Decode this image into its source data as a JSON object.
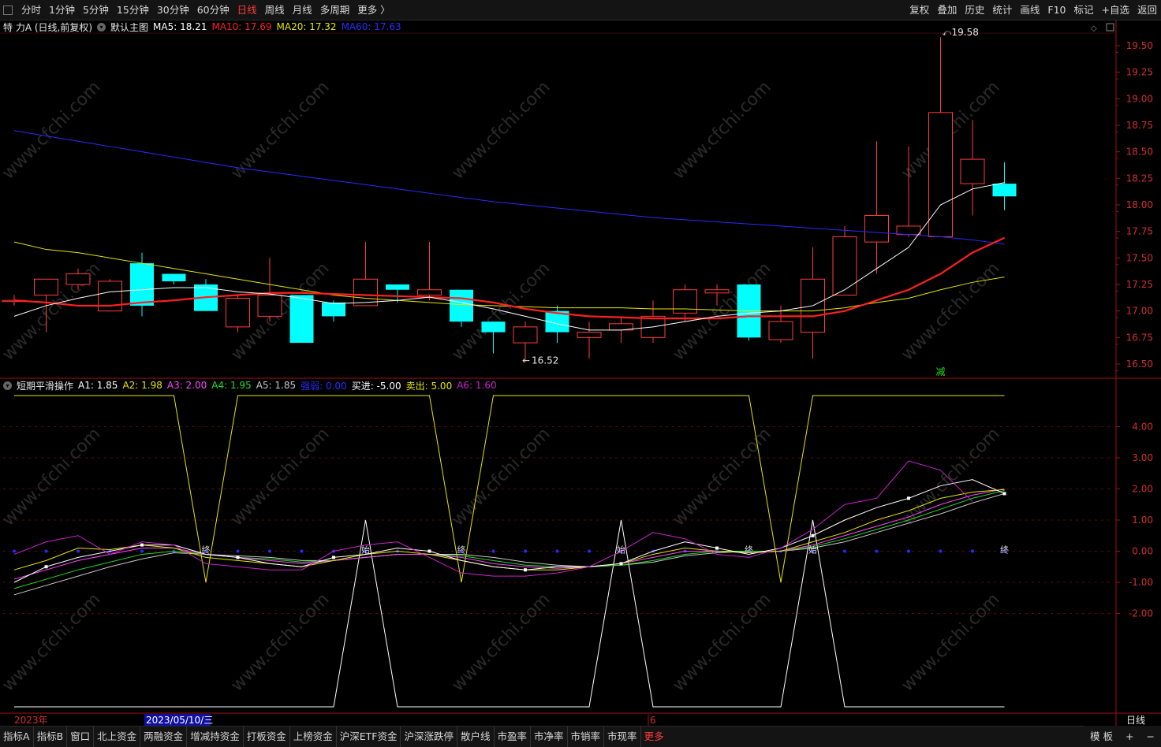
{
  "top_tabs": [
    "分时",
    "1分钟",
    "5分钟",
    "15分钟",
    "30分钟",
    "60分钟",
    "日线",
    "周线",
    "月线",
    "多周期",
    "更多 〉"
  ],
  "top_active": "日线",
  "top_right": [
    "复权",
    "叠加",
    "历史",
    "统计",
    "画线",
    "F10",
    "标记",
    "+自选",
    "返回"
  ],
  "main_legend": {
    "name": "特 力A (日线,前复权)",
    "template": "默认主图",
    "ma5": "MA5: 18.21",
    "ma10": "MA10: 17.69",
    "ma20": "MA20: 17.32",
    "ma60": "MA60: 17.63"
  },
  "sub_legend": {
    "name": "短期平滑操作",
    "a1": "A1: 1.85",
    "a2": "A2: 1.98",
    "a3": "A3: 2.00",
    "a4": "A4: 1.95",
    "a5": "A5: 1.85",
    "strong": "强弱: 0.00",
    "buy": "买进: -5.00",
    "sell": "卖出: 5.00",
    "a6": "A6: 1.60"
  },
  "colors": {
    "up": "#ff3b3b",
    "down": "#00ffff",
    "ma5": "#ffffff",
    "ma10": "#ff2020",
    "ma20": "#e6e600",
    "ma60": "#2a2aff",
    "a6": "#cc22cc"
  },
  "price_axis": [
    "19.50",
    "19.25",
    "19.00",
    "18.75",
    "18.50",
    "18.25",
    "18.00",
    "17.75",
    "17.50",
    "17.25",
    "17.00",
    "16.75",
    "16.50"
  ],
  "sub_axis": [
    "4.00",
    "3.00",
    "2.00",
    "1.00",
    "0.00",
    "-1.00",
    "-2.00"
  ],
  "annotations": {
    "high": "19.58",
    "low": "16.52",
    "reduce": "减",
    "end": "终"
  },
  "markers": [
    "终",
    "始",
    "终",
    "始",
    "终",
    "始",
    "终"
  ],
  "dates": {
    "year": "2023年",
    "cursor": "2023/05/10/三",
    "month": "6",
    "period": "日线"
  },
  "watermark": "www.cfchi.com",
  "bottom_tabs": [
    "指标A",
    "指标B",
    "窗口",
    "北上资金",
    "两融资金",
    "增减持资金",
    "打板资金",
    "上榜资金",
    "沪深ETF资金",
    "沪深涨跌停",
    "散户线",
    "市盈率",
    "市净率",
    "市销率",
    "市现率",
    "更多"
  ],
  "bottom_right": [
    "模 板",
    "+",
    "−"
  ],
  "chart_data": {
    "type": "candlestick",
    "ohlc": [
      [
        17.1,
        17.15,
        17.05,
        17.1
      ],
      [
        17.15,
        17.3,
        16.8,
        17.3
      ],
      [
        17.25,
        17.4,
        17.2,
        17.35
      ],
      [
        17.0,
        17.3,
        17.0,
        17.28
      ],
      [
        17.45,
        17.55,
        16.95,
        17.05
      ],
      [
        17.35,
        17.35,
        17.25,
        17.28
      ],
      [
        17.25,
        17.3,
        17.0,
        17.0
      ],
      [
        16.85,
        17.15,
        16.8,
        17.12
      ],
      [
        16.95,
        17.5,
        16.9,
        17.15
      ],
      [
        17.15,
        17.15,
        16.7,
        16.7
      ],
      [
        17.08,
        17.1,
        16.9,
        16.95
      ],
      [
        17.05,
        17.65,
        17.05,
        17.3
      ],
      [
        17.25,
        17.25,
        17.08,
        17.2
      ],
      [
        17.15,
        17.65,
        17.1,
        17.2
      ],
      [
        17.2,
        17.2,
        16.85,
        16.9
      ],
      [
        16.9,
        16.9,
        16.6,
        16.8
      ],
      [
        16.7,
        16.9,
        16.52,
        16.85
      ],
      [
        17.0,
        17.05,
        16.7,
        16.8
      ],
      [
        16.75,
        16.9,
        16.55,
        16.8
      ],
      [
        16.82,
        16.95,
        16.7,
        16.88
      ],
      [
        16.75,
        17.1,
        16.7,
        16.95
      ],
      [
        16.98,
        17.25,
        16.9,
        17.2
      ],
      [
        17.17,
        17.25,
        17.05,
        17.2
      ],
      [
        17.25,
        17.25,
        16.72,
        16.75
      ],
      [
        16.73,
        17.05,
        16.7,
        16.9
      ],
      [
        16.8,
        17.6,
        16.55,
        17.3
      ],
      [
        17.15,
        17.8,
        17.15,
        17.7
      ],
      [
        17.65,
        18.6,
        17.35,
        17.9
      ],
      [
        17.72,
        18.55,
        17.7,
        17.8
      ],
      [
        17.7,
        19.58,
        17.7,
        18.87
      ],
      [
        18.2,
        18.8,
        17.9,
        18.43
      ],
      [
        18.2,
        18.4,
        17.95,
        18.08
      ]
    ],
    "ma": {
      "MA5": [
        16.95,
        17.05,
        17.12,
        17.18,
        17.2,
        17.22,
        17.22,
        17.18,
        17.16,
        17.12,
        17.07,
        17.08,
        17.1,
        17.13,
        17.08,
        17.02,
        16.95,
        16.88,
        16.82,
        16.82,
        16.85,
        16.9,
        16.95,
        16.98,
        17.0,
        17.05,
        17.2,
        17.4,
        17.6,
        18.0,
        18.15,
        18.21
      ],
      "MA10": [
        17.1,
        17.08,
        17.05,
        17.05,
        17.08,
        17.1,
        17.13,
        17.15,
        17.17,
        17.17,
        17.16,
        17.15,
        17.14,
        17.13,
        17.12,
        17.08,
        17.02,
        16.98,
        16.95,
        16.94,
        16.93,
        16.93,
        16.93,
        16.95,
        16.95,
        16.95,
        17.0,
        17.1,
        17.2,
        17.35,
        17.55,
        17.69
      ],
      "MA20": [
        17.65,
        17.58,
        17.55,
        17.5,
        17.45,
        17.4,
        17.35,
        17.3,
        17.25,
        17.2,
        17.15,
        17.12,
        17.1,
        17.08,
        17.06,
        17.05,
        17.04,
        17.03,
        17.03,
        17.03,
        17.02,
        17.02,
        17.01,
        17.0,
        17.0,
        17.0,
        17.03,
        17.08,
        17.12,
        17.2,
        17.27,
        17.32
      ],
      "MA60": [
        18.7,
        18.65,
        18.6,
        18.55,
        18.5,
        18.45,
        18.4,
        18.35,
        18.31,
        18.27,
        18.23,
        18.19,
        18.15,
        18.11,
        18.07,
        18.03,
        18.0,
        17.97,
        17.94,
        17.91,
        17.88,
        17.86,
        17.84,
        17.82,
        17.8,
        17.78,
        17.76,
        17.74,
        17.72,
        17.7,
        17.67,
        17.63
      ]
    },
    "yaxis": {
      "min": 16.5,
      "max": 19.5
    },
    "indicator": {
      "A1": [
        -1.0,
        -0.5,
        -0.2,
        0.0,
        0.2,
        0.2,
        -0.1,
        -0.2,
        -0.4,
        -0.5,
        -0.2,
        -0.1,
        0.1,
        0.0,
        -0.3,
        -0.5,
        -0.6,
        -0.5,
        -0.5,
        -0.4,
        0.0,
        0.3,
        0.1,
        -0.1,
        0.1,
        0.5,
        1.0,
        1.4,
        1.7,
        2.1,
        2.3,
        1.85
      ],
      "A2": [
        -0.6,
        -0.3,
        0.1,
        0.05,
        0.2,
        0.1,
        -0.2,
        -0.3,
        -0.4,
        -0.5,
        -0.3,
        -0.1,
        0.0,
        -0.1,
        -0.3,
        -0.5,
        -0.6,
        -0.6,
        -0.5,
        -0.4,
        -0.1,
        0.1,
        0.0,
        -0.05,
        0.0,
        0.3,
        0.6,
        1.0,
        1.3,
        1.7,
        1.9,
        1.98
      ],
      "A3": [
        -0.9,
        -0.6,
        -0.3,
        -0.1,
        0.1,
        0.1,
        -0.1,
        -0.2,
        -0.3,
        -0.4,
        -0.3,
        -0.2,
        -0.1,
        -0.1,
        -0.2,
        -0.4,
        -0.5,
        -0.55,
        -0.5,
        -0.4,
        -0.2,
        0.0,
        0.0,
        -0.05,
        0.0,
        0.2,
        0.5,
        0.8,
        1.1,
        1.5,
        1.8,
        2.0
      ],
      "A4": [
        -1.2,
        -0.9,
        -0.6,
        -0.35,
        -0.1,
        0.0,
        -0.1,
        -0.2,
        -0.25,
        -0.35,
        -0.3,
        -0.2,
        -0.1,
        -0.1,
        -0.15,
        -0.3,
        -0.45,
        -0.5,
        -0.5,
        -0.45,
        -0.3,
        -0.1,
        0.0,
        0.0,
        0.0,
        0.15,
        0.4,
        0.7,
        1.0,
        1.35,
        1.7,
        1.95
      ],
      "A5": [
        -1.4,
        -1.1,
        -0.8,
        -0.5,
        -0.25,
        -0.05,
        -0.1,
        -0.15,
        -0.2,
        -0.3,
        -0.3,
        -0.2,
        -0.1,
        -0.1,
        -0.1,
        -0.2,
        -0.35,
        -0.45,
        -0.5,
        -0.45,
        -0.35,
        -0.15,
        -0.05,
        0.0,
        0.0,
        0.1,
        0.3,
        0.6,
        0.9,
        1.2,
        1.55,
        1.85
      ],
      "A6": [
        -0.1,
        0.3,
        0.5,
        -0.1,
        0.3,
        0.2,
        -0.4,
        -0.5,
        -0.6,
        -0.6,
        0.0,
        0.2,
        0.3,
        -0.2,
        -0.7,
        -0.8,
        -0.8,
        -0.7,
        -0.5,
        0.0,
        0.6,
        0.4,
        -0.1,
        -0.2,
        0.1,
        0.7,
        1.5,
        1.7,
        2.9,
        2.6,
        1.6
      ],
      "strong": 0,
      "buy": -5,
      "sell": 5,
      "yaxis": {
        "min": -5,
        "max": 5
      }
    }
  }
}
